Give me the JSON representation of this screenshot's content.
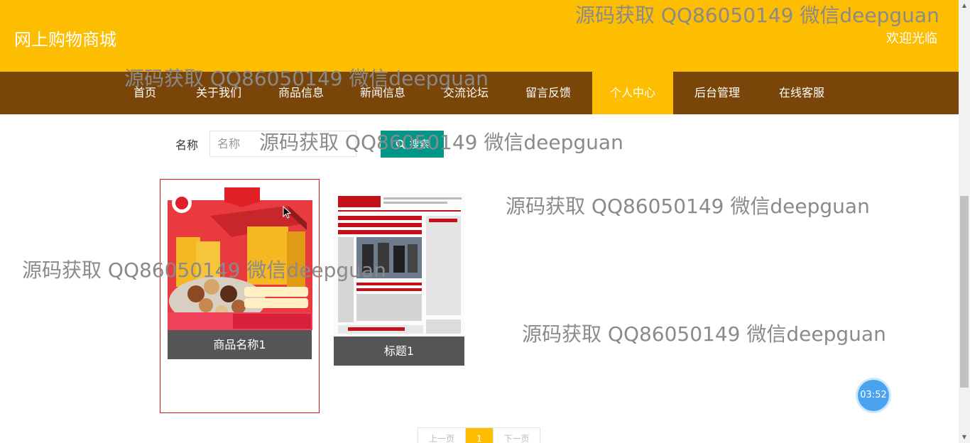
{
  "header": {
    "title": "网上购物商城",
    "welcome": "欢迎光临"
  },
  "nav": {
    "items": [
      {
        "label": "首页"
      },
      {
        "label": "关于我们"
      },
      {
        "label": "商品信息"
      },
      {
        "label": "新闻信息"
      },
      {
        "label": "交流论坛"
      },
      {
        "label": "留言反馈"
      },
      {
        "label": "个人中心",
        "active": true
      },
      {
        "label": "后台管理"
      },
      {
        "label": "在线客服"
      }
    ]
  },
  "search": {
    "label": "名称",
    "placeholder": "名称",
    "button_label": "搜索"
  },
  "products": [
    {
      "title": "商品名称1"
    },
    {
      "title": "标题1"
    }
  ],
  "watermark": {
    "text": "源码获取 QQ86050149 微信deepguan"
  },
  "pagination": {
    "prev": "上一页",
    "current": "1",
    "next": "下一页"
  },
  "timer": {
    "value": "03:52"
  },
  "colors": {
    "header": "#fdbd00",
    "nav": "#7a4509",
    "nav_active": "#fdbd00",
    "search_button": "#009688",
    "caption": "#555555",
    "card_border": "#d21a1a"
  }
}
